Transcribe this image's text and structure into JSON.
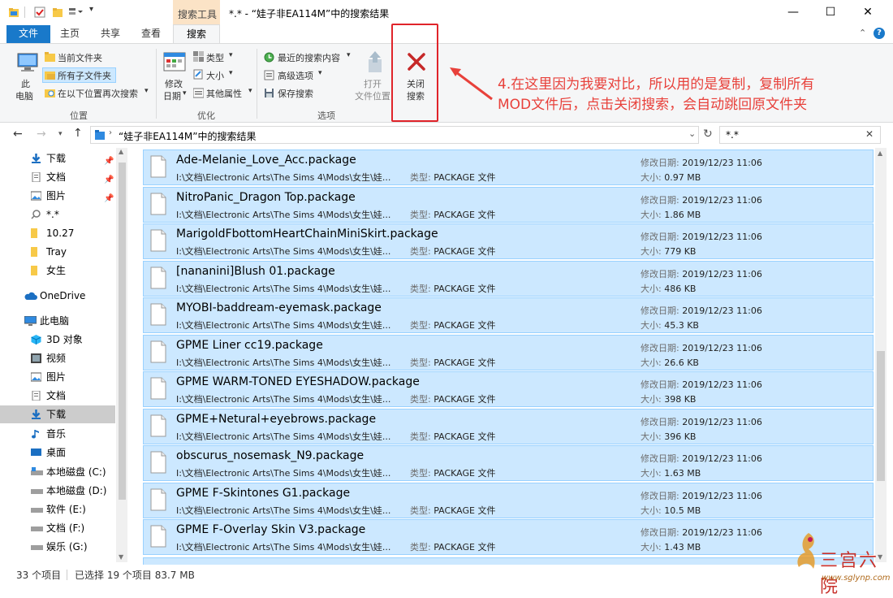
{
  "titlebar": {
    "context_tab": "搜索工具",
    "title": "*.* - “娃子非EA114M”中的搜索结果",
    "minimize": "—",
    "maximize": "☐",
    "close": "✕"
  },
  "tabs": {
    "file": "文件",
    "home": "主页",
    "share": "共享",
    "view": "查看",
    "search": "搜索"
  },
  "ribbon": {
    "pc_l1": "此",
    "pc_l2": "电脑",
    "current_folder": "当前文件夹",
    "all_subfolders": "所有子文件夹",
    "search_again": "在以下位置再次搜索",
    "group_location": "位置",
    "modified_l1": "修改",
    "modified_l2": "日期",
    "type": "类型",
    "size": "大小",
    "other_props": "其他属性",
    "group_refine": "优化",
    "recent_searches": "最近的搜索内容",
    "advanced": "高级选项",
    "save_search": "保存搜索",
    "group_options": "选项",
    "open_l1": "打开",
    "open_l2": "文件位置",
    "close_l1": "关闭",
    "close_l2": "搜索"
  },
  "annotation": {
    "line1": "4.在这里因为我要对比，所以用的是复制，复制所有",
    "line2": "MOD文件后，点击关闭搜索，会自动跳回原文件夹"
  },
  "address": {
    "path": "“娃子非EA114M”中的搜索结果",
    "search_value": "*.*"
  },
  "nav": {
    "downloads_pinned": "下载",
    "documents_pinned": "文档",
    "pictures_pinned": "图片",
    "search_item": "*.*",
    "f1027": "10.27",
    "tray": "Tray",
    "nvsheng": "女生",
    "onedrive": "OneDrive",
    "thispc": "此电脑",
    "objects3d": "3D 对象",
    "videos": "视频",
    "pictures": "图片",
    "documents": "文档",
    "downloads": "下载",
    "music": "音乐",
    "desktop": "桌面",
    "disk_c": "本地磁盘 (C:)",
    "disk_d": "本地磁盘 (D:)",
    "disk_e": "软件 (E:)",
    "disk_f": "文档 (F:)",
    "disk_g": "娱乐 (G:)"
  },
  "files_common": {
    "path": "I:\\文档\\Electronic Arts\\The Sims 4\\Mods\\女生\\娃...",
    "type_label": "类型:",
    "type_value": "PACKAGE 文件",
    "date_label": "修改日期:",
    "size_label": "大小:"
  },
  "files": [
    {
      "name": "Ade-Melanie_Love_Acc.package",
      "date": "2019/12/23 11:06",
      "size": "0.97 MB"
    },
    {
      "name": "NitroPanic_Dragon Top.package",
      "date": "2019/12/23 11:06",
      "size": "1.86 MB"
    },
    {
      "name": "MarigoldFbottomHeartChainMiniSkirt.package",
      "date": "2019/12/23 11:06",
      "size": "779 KB"
    },
    {
      "name": "[nananini]Blush 01.package",
      "date": "2019/12/23 11:06",
      "size": "486 KB"
    },
    {
      "name": "MYOBI-baddream-eyemask.package",
      "date": "2019/12/23 11:06",
      "size": "45.3 KB"
    },
    {
      "name": "GPME Liner cc19.package",
      "date": "2019/12/23 11:06",
      "size": "26.6 KB"
    },
    {
      "name": "GPME WARM-TONED EYESHADOW.package",
      "date": "2019/12/23 11:06",
      "size": "398 KB"
    },
    {
      "name": "GPME+Netural+eyebrows.package",
      "date": "2019/12/23 11:06",
      "size": "396 KB"
    },
    {
      "name": "obscurus_nosemask_N9.package",
      "date": "2019/12/23 11:06",
      "size": "1.63 MB"
    },
    {
      "name": "GPME F-Skintones G1.package",
      "date": "2019/12/23 11:06",
      "size": "10.5 MB"
    },
    {
      "name": "GPME F-Overlay Skin V3.package",
      "date": "2019/12/23 11:06",
      "size": "1.43 MB"
    }
  ],
  "status": {
    "count": "33 个项目",
    "selected": "已选择 19 个项目  83.7 MB"
  },
  "watermark": {
    "name": "三宫六院",
    "url": "www.sglynp.com"
  },
  "colors": {
    "accent": "#1979ca",
    "selection": "#cce8ff",
    "selection_border": "#99d1ff",
    "annotation": "#e8413b"
  }
}
